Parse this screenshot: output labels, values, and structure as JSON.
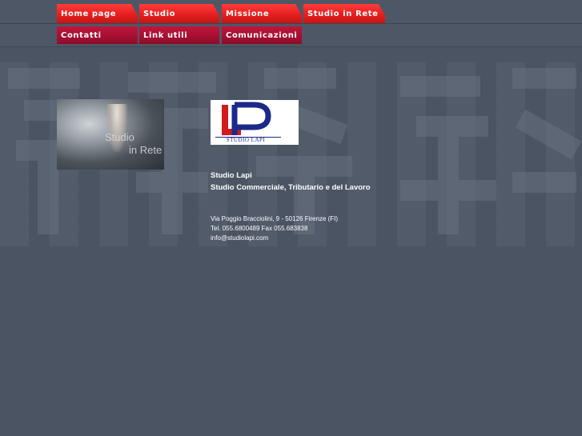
{
  "nav": {
    "row1": [
      {
        "label": "Home page"
      },
      {
        "label": "Studio"
      },
      {
        "label": "Missione"
      },
      {
        "label": "Studio in Rete"
      }
    ],
    "row2": [
      {
        "label": "Contatti"
      },
      {
        "label": "Link utili"
      },
      {
        "label": "Comunicazioni"
      }
    ]
  },
  "photo": {
    "caption_line1": "Studio",
    "caption_line2": "in Rete"
  },
  "logo": {
    "monogram": "LP",
    "caption": "STUDIO LAPI"
  },
  "content": {
    "title": "Studio Lapi",
    "subtitle": "Studio Commerciale, Tributario e del Lavoro",
    "address": "Via Poggio Bracciolini, 9 - 50126 Firenze (FI)",
    "phone": "Tel. 055.6800489 Fax 055.683838",
    "email": "info@studiolapi.com"
  },
  "colors": {
    "background": "#4b5462",
    "nav_red": "#e41f1f",
    "nav_dark_red": "#a30f31",
    "text": "#ffffff",
    "logo_blue": "#1a2a8a",
    "logo_red": "#d11a1a"
  }
}
